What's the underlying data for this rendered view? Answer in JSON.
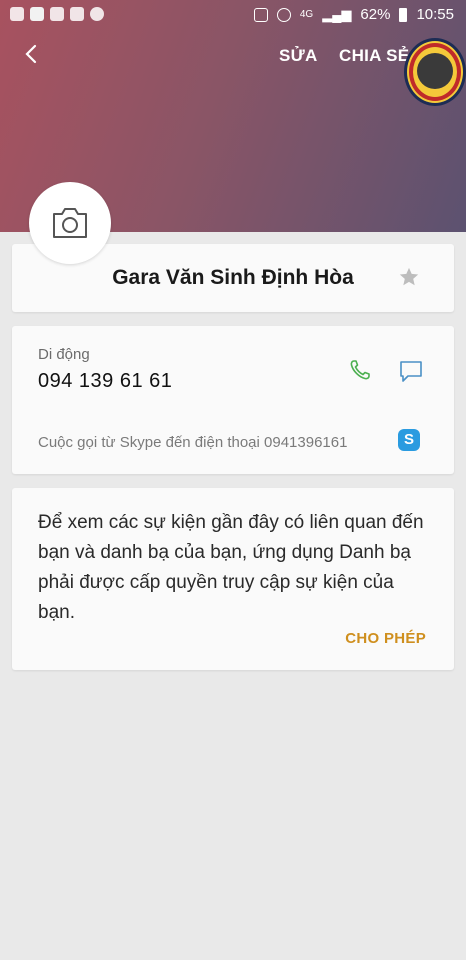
{
  "status_bar": {
    "battery": "62%",
    "time": "10:55"
  },
  "header": {
    "back_icon": "chevron-left-icon",
    "edit_label": "SỬA",
    "share_label": "CHIA SẺ"
  },
  "contact": {
    "name": "Gara Văn Sinh Định Hòa",
    "phone_label": "Di động",
    "phone_number": "094 139 61 61",
    "skype_call_text": "Cuộc gọi từ Skype đến điện thoại 0941396161"
  },
  "permission_card": {
    "message": "Để xem các sự kiện gần đây có liên quan đến bạn và danh bạ của bạn, ứng dụng Danh bạ phải được cấp quyền truy cập sự kiện của bạn.",
    "allow_label": "CHO PHÉP"
  },
  "colors": {
    "accent": "#cf8f1e",
    "call_green": "#4caf50",
    "message_blue": "#4a90c6",
    "skype": "#2a9be0"
  }
}
